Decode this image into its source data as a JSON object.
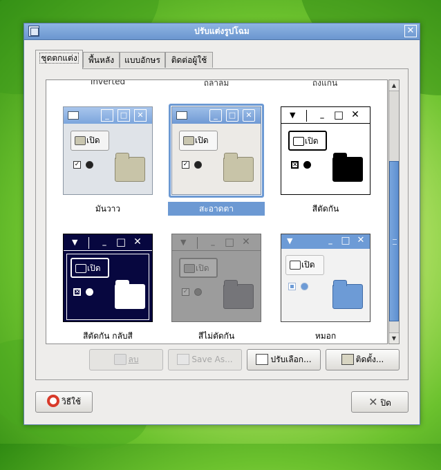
{
  "window": {
    "title": "ปรับแต่งรูปโฉม"
  },
  "tabs": [
    {
      "label": "ชุดตกแต่ง"
    },
    {
      "label": "พื้นหลัง"
    },
    {
      "label": "แบบอักษร"
    },
    {
      "label": "ติดต่อผู้ใช้"
    }
  ],
  "themes": {
    "partial_top": [
      "Inverted",
      "ถลาลม",
      "ถงแกน"
    ],
    "items": [
      {
        "label": "มันวาว",
        "button": "เปิด",
        "selected": false
      },
      {
        "label": "สะอาดตา",
        "button": "เปิด",
        "selected": true
      },
      {
        "label": "สีตัดกัน",
        "button": "เปิด",
        "selected": false
      },
      {
        "label": "สีตัดกัน กลับสี",
        "button": "เปิด",
        "selected": false
      },
      {
        "label": "สีไม่ตัดกัน",
        "button": "เปิด",
        "selected": false
      },
      {
        "label": "หมอก",
        "button": "เปิด",
        "selected": false
      }
    ]
  },
  "actions": {
    "delete": "ลบ",
    "save_as": "Save As...",
    "customize": "ปรับเลือก...",
    "install": "ติดตั้ง..."
  },
  "footer": {
    "help": "วิธีใช้",
    "close": "ปิด"
  },
  "colors": {
    "selection": "#6c99d3",
    "titlebar": "#7aa3d8",
    "scroll_thumb": "#6896d6"
  }
}
